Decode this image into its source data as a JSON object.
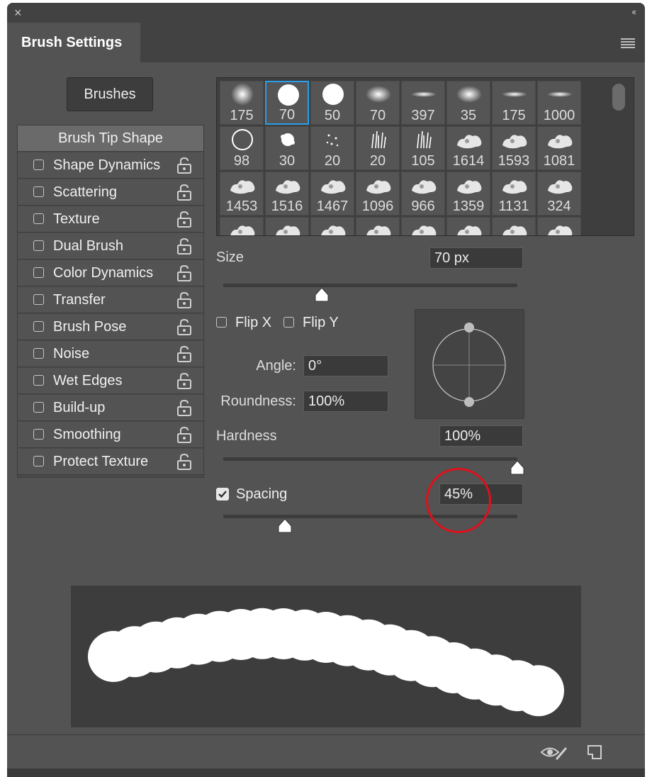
{
  "panel": {
    "title": "Brush Settings",
    "close_icon": "×",
    "collapse_icon": "‹‹"
  },
  "brushes_button": "Brushes",
  "sidebar": {
    "items": [
      {
        "label": "Brush Tip Shape",
        "active": true,
        "checkbox": false,
        "lock": false
      },
      {
        "label": "Shape Dynamics",
        "checkbox": true,
        "lock": true
      },
      {
        "label": "Scattering",
        "checkbox": true,
        "lock": true
      },
      {
        "label": "Texture",
        "checkbox": true,
        "lock": true
      },
      {
        "label": "Dual Brush",
        "checkbox": true,
        "lock": true
      },
      {
        "label": "Color Dynamics",
        "checkbox": true,
        "lock": true
      },
      {
        "label": "Transfer",
        "checkbox": true,
        "lock": true
      },
      {
        "label": "Brush Pose",
        "checkbox": true,
        "lock": true
      },
      {
        "label": "Noise",
        "checkbox": true,
        "lock": true
      },
      {
        "label": "Wet Edges",
        "checkbox": true,
        "lock": true
      },
      {
        "label": "Build-up",
        "checkbox": true,
        "lock": true
      },
      {
        "label": "Smoothing",
        "checkbox": true,
        "lock": true
      },
      {
        "label": "Protect Texture",
        "checkbox": true,
        "lock": true
      }
    ]
  },
  "brush_grid": [
    {
      "n": "175",
      "shape": "soft"
    },
    {
      "n": "70",
      "shape": "hard",
      "selected": true
    },
    {
      "n": "50",
      "shape": "hard"
    },
    {
      "n": "70",
      "shape": "soft-oval"
    },
    {
      "n": "397",
      "shape": "line"
    },
    {
      "n": "35",
      "shape": "soft-oval"
    },
    {
      "n": "175",
      "shape": "line"
    },
    {
      "n": "1000",
      "shape": "line"
    },
    {
      "n": "98",
      "shape": "ring"
    },
    {
      "n": "30",
      "shape": "rough"
    },
    {
      "n": "20",
      "shape": "dots"
    },
    {
      "n": "20",
      "shape": "grass"
    },
    {
      "n": "105",
      "shape": "grass"
    },
    {
      "n": "1614",
      "shape": "cloud"
    },
    {
      "n": "1593",
      "shape": "cloud"
    },
    {
      "n": "1081",
      "shape": "cloud"
    },
    {
      "n": "1453",
      "shape": "cloud"
    },
    {
      "n": "1516",
      "shape": "cloud"
    },
    {
      "n": "1467",
      "shape": "cloud"
    },
    {
      "n": "1096",
      "shape": "cloud"
    },
    {
      "n": "966",
      "shape": "cloud"
    },
    {
      "n": "1359",
      "shape": "cloud"
    },
    {
      "n": "1131",
      "shape": "cloud"
    },
    {
      "n": "324",
      "shape": "cloud"
    },
    {
      "n": "",
      "shape": "cloud"
    },
    {
      "n": "",
      "shape": "cloud"
    },
    {
      "n": "",
      "shape": "cloud"
    },
    {
      "n": "",
      "shape": "cloud"
    },
    {
      "n": "",
      "shape": "cloud"
    },
    {
      "n": "",
      "shape": "cloud"
    },
    {
      "n": "",
      "shape": "cloud"
    },
    {
      "n": "",
      "shape": "cloud"
    }
  ],
  "size": {
    "label": "Size",
    "value": "70 px",
    "slider_fraction": 0.336
  },
  "flip": {
    "x_label": "Flip X",
    "y_label": "Flip Y",
    "x_checked": false,
    "y_checked": false
  },
  "angle": {
    "label": "Angle:",
    "value": "0°"
  },
  "roundness": {
    "label": "Roundness:",
    "value": "100%"
  },
  "hardness": {
    "label": "Hardness",
    "value": "100%",
    "slider_fraction": 1.0
  },
  "spacing": {
    "label": "Spacing",
    "value": "45%",
    "checked": true,
    "slider_fraction": 0.21
  },
  "footer": {
    "eye_icon": "eye-brush-icon",
    "new_icon": "new-brush-icon"
  },
  "colors": {
    "panel_bg": "#535353",
    "dark_bg": "#424242",
    "selection": "#2a9ee8",
    "highlight_circle": "#e0101c"
  }
}
